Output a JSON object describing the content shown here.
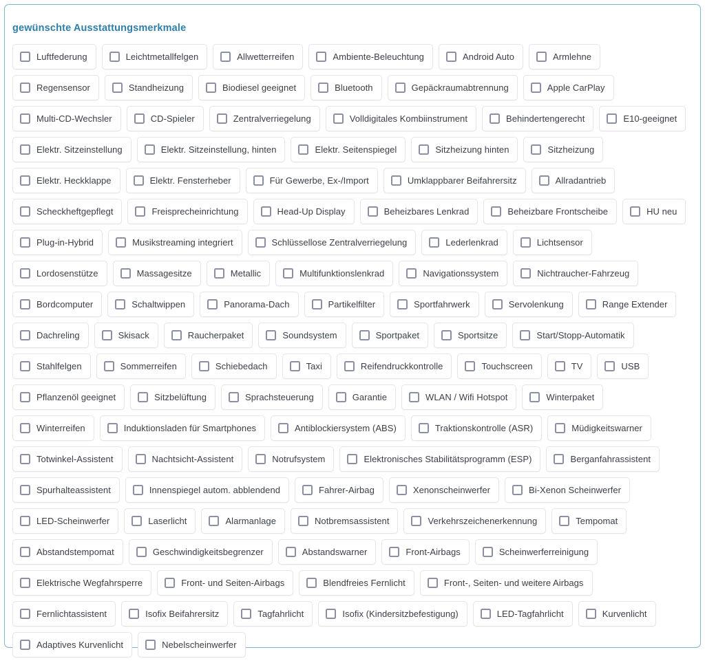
{
  "panel": {
    "title": "gewünschte Ausstattungsmerkmale",
    "border_color": "#7fb3d0",
    "title_color": "#2e7fa8",
    "chip_border_color": "#e3e5e8",
    "checkbox_border_color": "#8a8fa3",
    "label_color": "#3a3f46"
  },
  "checkbox_icon_name": "checkbox-unchecked-icon",
  "options": [
    {
      "label": "Luftfederung",
      "checked": false
    },
    {
      "label": "Leichtmetallfelgen",
      "checked": false
    },
    {
      "label": "Allwetterreifen",
      "checked": false
    },
    {
      "label": "Ambiente-Beleuchtung",
      "checked": false
    },
    {
      "label": "Android Auto",
      "checked": false
    },
    {
      "label": "Armlehne",
      "checked": false
    },
    {
      "label": "Regensensor",
      "checked": false
    },
    {
      "label": "Standheizung",
      "checked": false
    },
    {
      "label": "Biodiesel geeignet",
      "checked": false
    },
    {
      "label": "Bluetooth",
      "checked": false
    },
    {
      "label": "Gepäckraumabtrennung",
      "checked": false
    },
    {
      "label": "Apple CarPlay",
      "checked": false
    },
    {
      "label": "Multi-CD-Wechsler",
      "checked": false
    },
    {
      "label": "CD-Spieler",
      "checked": false
    },
    {
      "label": "Zentralverriegelung",
      "checked": false
    },
    {
      "label": "Volldigitales Kombiinstrument",
      "checked": false
    },
    {
      "label": "Behindertengerecht",
      "checked": false
    },
    {
      "label": "E10-geeignet",
      "checked": false
    },
    {
      "label": "Elektr. Sitzeinstellung",
      "checked": false
    },
    {
      "label": "Elektr. Sitzeinstellung, hinten",
      "checked": false
    },
    {
      "label": "Elektr. Seitenspiegel",
      "checked": false
    },
    {
      "label": "Sitzheizung hinten",
      "checked": false
    },
    {
      "label": "Sitzheizung",
      "checked": false
    },
    {
      "label": "Elektr. Heckklappe",
      "checked": false
    },
    {
      "label": "Elektr. Fensterheber",
      "checked": false
    },
    {
      "label": "Für Gewerbe, Ex-/Import",
      "checked": false
    },
    {
      "label": "Umklappbarer Beifahrersitz",
      "checked": false
    },
    {
      "label": "Allradantrieb",
      "checked": false
    },
    {
      "label": "Scheckheftgepflegt",
      "checked": false
    },
    {
      "label": "Freisprecheinrichtung",
      "checked": false
    },
    {
      "label": "Head-Up Display",
      "checked": false
    },
    {
      "label": "Beheizbares Lenkrad",
      "checked": false
    },
    {
      "label": "Beheizbare Frontscheibe",
      "checked": false
    },
    {
      "label": "HU neu",
      "checked": false
    },
    {
      "label": "Plug-in-Hybrid",
      "checked": false
    },
    {
      "label": "Musikstreaming integriert",
      "checked": false
    },
    {
      "label": "Schlüssellose Zentralverriegelung",
      "checked": false
    },
    {
      "label": "Lederlenkrad",
      "checked": false
    },
    {
      "label": "Lichtsensor",
      "checked": false
    },
    {
      "label": "Lordosenstütze",
      "checked": false
    },
    {
      "label": "Massagesitze",
      "checked": false
    },
    {
      "label": "Metallic",
      "checked": false
    },
    {
      "label": "Multifunktionslenkrad",
      "checked": false
    },
    {
      "label": "Navigationssystem",
      "checked": false
    },
    {
      "label": "Nichtraucher-Fahrzeug",
      "checked": false
    },
    {
      "label": "Bordcomputer",
      "checked": false
    },
    {
      "label": "Schaltwippen",
      "checked": false
    },
    {
      "label": "Panorama-Dach",
      "checked": false
    },
    {
      "label": "Partikelfilter",
      "checked": false
    },
    {
      "label": "Sportfahrwerk",
      "checked": false
    },
    {
      "label": "Servolenkung",
      "checked": false
    },
    {
      "label": "Range Extender",
      "checked": false
    },
    {
      "label": "Dachreling",
      "checked": false
    },
    {
      "label": "Skisack",
      "checked": false
    },
    {
      "label": "Raucherpaket",
      "checked": false
    },
    {
      "label": "Soundsystem",
      "checked": false
    },
    {
      "label": "Sportpaket",
      "checked": false
    },
    {
      "label": "Sportsitze",
      "checked": false
    },
    {
      "label": "Start/Stopp-Automatik",
      "checked": false
    },
    {
      "label": "Stahlfelgen",
      "checked": false
    },
    {
      "label": "Sommerreifen",
      "checked": false
    },
    {
      "label": "Schiebedach",
      "checked": false
    },
    {
      "label": "Taxi",
      "checked": false
    },
    {
      "label": "Reifendruckkontrolle",
      "checked": false
    },
    {
      "label": "Touchscreen",
      "checked": false
    },
    {
      "label": "TV",
      "checked": false
    },
    {
      "label": "USB",
      "checked": false
    },
    {
      "label": "Pflanzenöl geeignet",
      "checked": false
    },
    {
      "label": "Sitzbelüftung",
      "checked": false
    },
    {
      "label": "Sprachsteuerung",
      "checked": false
    },
    {
      "label": "Garantie",
      "checked": false
    },
    {
      "label": "WLAN / Wifi Hotspot",
      "checked": false
    },
    {
      "label": "Winterpaket",
      "checked": false
    },
    {
      "label": "Winterreifen",
      "checked": false
    },
    {
      "label": "Induktionsladen für Smartphones",
      "checked": false
    },
    {
      "label": "Antiblockiersystem (ABS)",
      "checked": false
    },
    {
      "label": "Traktionskontrolle (ASR)",
      "checked": false
    },
    {
      "label": "Müdigkeitswarner",
      "checked": false
    },
    {
      "label": "Totwinkel-Assistent",
      "checked": false
    },
    {
      "label": "Nachtsicht-Assistent",
      "checked": false
    },
    {
      "label": "Notrufsystem",
      "checked": false
    },
    {
      "label": "Elektronisches Stabilitätsprogramm (ESP)",
      "checked": false
    },
    {
      "label": "Berganfahrassistent",
      "checked": false
    },
    {
      "label": "Spurhalteassistent",
      "checked": false
    },
    {
      "label": "Innenspiegel autom. abblendend",
      "checked": false
    },
    {
      "label": "Fahrer-Airbag",
      "checked": false
    },
    {
      "label": "Xenonscheinwerfer",
      "checked": false
    },
    {
      "label": "Bi-Xenon Scheinwerfer",
      "checked": false
    },
    {
      "label": "LED-Scheinwerfer",
      "checked": false
    },
    {
      "label": "Laserlicht",
      "checked": false
    },
    {
      "label": "Alarmanlage",
      "checked": false
    },
    {
      "label": "Notbremsassistent",
      "checked": false
    },
    {
      "label": "Verkehrszeichenerkennung",
      "checked": false
    },
    {
      "label": "Tempomat",
      "checked": false
    },
    {
      "label": "Abstandstempomat",
      "checked": false
    },
    {
      "label": "Geschwindigkeitsbegrenzer",
      "checked": false
    },
    {
      "label": "Abstandswarner",
      "checked": false
    },
    {
      "label": "Front-Airbags",
      "checked": false
    },
    {
      "label": "Scheinwerferreinigung",
      "checked": false
    },
    {
      "label": "Elektrische Wegfahrsperre",
      "checked": false
    },
    {
      "label": "Front- und Seiten-Airbags",
      "checked": false
    },
    {
      "label": "Blendfreies Fernlicht",
      "checked": false
    },
    {
      "label": "Front-, Seiten- und weitere Airbags",
      "checked": false
    },
    {
      "label": "Fernlichtassistent",
      "checked": false
    },
    {
      "label": "Isofix Beifahrersitz",
      "checked": false
    },
    {
      "label": "Tagfahrlicht",
      "checked": false
    },
    {
      "label": "Isofix (Kindersitzbefestigung)",
      "checked": false
    },
    {
      "label": "LED-Tagfahrlicht",
      "checked": false
    },
    {
      "label": "Kurvenlicht",
      "checked": false
    },
    {
      "label": "Adaptives Kurvenlicht",
      "checked": false
    },
    {
      "label": "Nebelscheinwerfer",
      "checked": false
    }
  ]
}
